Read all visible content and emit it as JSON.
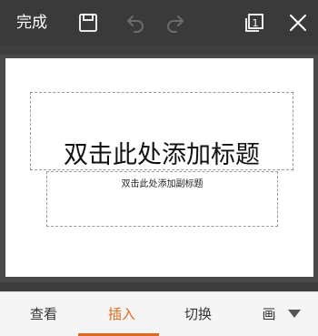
{
  "toolbar": {
    "done_label": "完成",
    "page_count": "1",
    "icons": [
      "save-icon",
      "undo-icon",
      "redo-icon",
      "pages-icon",
      "close-icon"
    ]
  },
  "slide": {
    "title_placeholder": "双击此处添加标题",
    "subtitle_placeholder": "双击此处添加副标题"
  },
  "tabs": {
    "view": "查看",
    "insert": "插入",
    "switch": "切换",
    "draw": "画",
    "active": "insert",
    "more_icon": "chevron-down-icon"
  },
  "colors": {
    "accent": "#e06a1b",
    "toolbar_bg": "#3a3a3a",
    "tabbar_bg": "#f5f5f5"
  }
}
